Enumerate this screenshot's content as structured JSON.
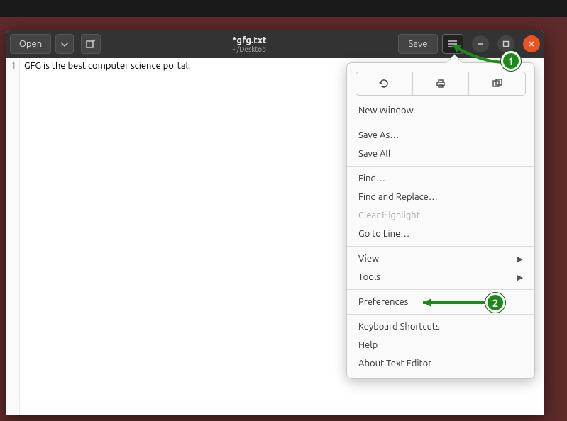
{
  "desktop": {},
  "titlebar": {
    "open_label": "Open",
    "title": "*gfg.txt",
    "subtitle": "~/Desktop",
    "save_label": "Save"
  },
  "editor": {
    "line_number": "1",
    "content": "GFG is the best computer science portal."
  },
  "menu": {
    "icons": [
      "reload-icon",
      "print-icon",
      "fullscreen-icon"
    ],
    "groups": [
      [
        {
          "label": "New Window",
          "disabled": false,
          "sub": false
        }
      ],
      [
        {
          "label": "Save As…",
          "disabled": false,
          "sub": false
        },
        {
          "label": "Save All",
          "disabled": false,
          "sub": false
        }
      ],
      [
        {
          "label": "Find…",
          "disabled": false,
          "sub": false
        },
        {
          "label": "Find and Replace…",
          "disabled": false,
          "sub": false
        },
        {
          "label": "Clear Highlight",
          "disabled": true,
          "sub": false
        },
        {
          "label": "Go to Line…",
          "disabled": false,
          "sub": false
        }
      ],
      [
        {
          "label": "View",
          "disabled": false,
          "sub": true
        },
        {
          "label": "Tools",
          "disabled": false,
          "sub": true
        }
      ],
      [
        {
          "label": "Preferences",
          "disabled": false,
          "sub": false
        }
      ],
      [
        {
          "label": "Keyboard Shortcuts",
          "disabled": false,
          "sub": false
        },
        {
          "label": "Help",
          "disabled": false,
          "sub": false
        },
        {
          "label": "About Text Editor",
          "disabled": false,
          "sub": false
        }
      ]
    ]
  },
  "annotations": {
    "badge1": "1",
    "badge2": "2"
  },
  "colors": {
    "accent": "#e95420",
    "annotation": "#1b8a1b"
  }
}
